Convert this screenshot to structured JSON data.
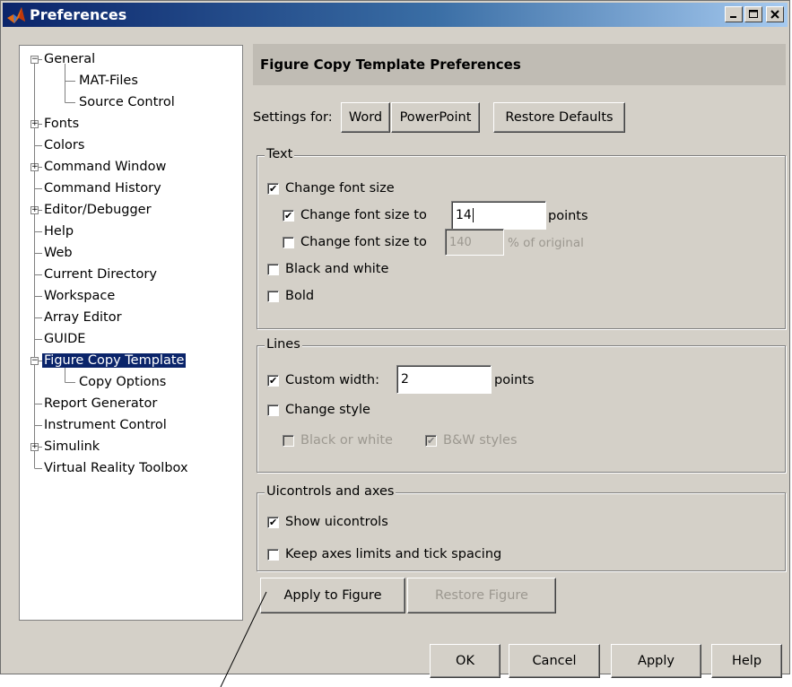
{
  "window": {
    "title": "Preferences"
  },
  "tree": {
    "items": [
      {
        "label": "General",
        "expander": "−",
        "selected": false
      },
      {
        "label": "MAT-Files",
        "selected": false
      },
      {
        "label": "Source Control",
        "selected": false
      },
      {
        "label": "Fonts",
        "expander": "+",
        "selected": false
      },
      {
        "label": "Colors",
        "selected": false
      },
      {
        "label": "Command Window",
        "expander": "+",
        "selected": false
      },
      {
        "label": "Command History",
        "selected": false
      },
      {
        "label": "Editor/Debugger",
        "expander": "+",
        "selected": false
      },
      {
        "label": "Help",
        "selected": false
      },
      {
        "label": "Web",
        "selected": false
      },
      {
        "label": "Current Directory",
        "selected": false
      },
      {
        "label": "Workspace",
        "selected": false
      },
      {
        "label": "Array Editor",
        "selected": false
      },
      {
        "label": "GUIDE",
        "selected": false
      },
      {
        "label": "Figure Copy Template",
        "expander": "−",
        "selected": true
      },
      {
        "label": "Copy Options",
        "selected": false
      },
      {
        "label": "Report Generator",
        "selected": false
      },
      {
        "label": "Instrument Control",
        "selected": false
      },
      {
        "label": "Simulink",
        "expander": "+",
        "selected": false
      },
      {
        "label": "Virtual Reality Toolbox",
        "selected": false
      }
    ]
  },
  "panel": {
    "title": "Figure Copy Template Preferences",
    "settings_for_label": "Settings for:",
    "word_button": "Word",
    "powerpoint_button": "PowerPoint",
    "restore_defaults_button": "Restore Defaults"
  },
  "text_group": {
    "title": "Text",
    "change_font_size": {
      "label": "Change font size",
      "checked": true
    },
    "font_size_to": {
      "label": "Change font size to",
      "value": "14",
      "unit": "points",
      "checked": true
    },
    "font_size_pct": {
      "label": "Change font size to",
      "value": "140",
      "unit": "% of original",
      "checked": false
    },
    "black_and_white": {
      "label": "Black and white",
      "checked": false
    },
    "bold": {
      "label": "Bold",
      "checked": false
    }
  },
  "lines_group": {
    "title": "Lines",
    "custom_width": {
      "label": "Custom width:",
      "value": "2",
      "unit": "points",
      "checked": true
    },
    "change_style": {
      "label": "Change style",
      "checked": false
    },
    "black_or_white": {
      "label": "Black or white",
      "checked": false
    },
    "bw_styles": {
      "label": "B&W styles",
      "checked": true
    }
  },
  "ui_group": {
    "title": "Uicontrols and axes",
    "show_uicontrols": {
      "label": "Show uicontrols",
      "checked": true
    },
    "keep_axes": {
      "label": "Keep axes limits and tick spacing",
      "checked": false
    }
  },
  "actions": {
    "apply_to_figure": "Apply to Figure",
    "restore_figure": "Restore Figure"
  },
  "footer": {
    "ok": "OK",
    "cancel": "Cancel",
    "apply": "Apply",
    "help": "Help"
  },
  "icons": {
    "title": "matlab-logo-icon",
    "minimize": "minimize-icon",
    "maximize": "maximize-icon",
    "close": "close-icon",
    "check": "checkmark-icon"
  },
  "colors": {
    "title_bar": "#0a246a",
    "face": "#d4d0c8",
    "selection": "#0a246a"
  }
}
